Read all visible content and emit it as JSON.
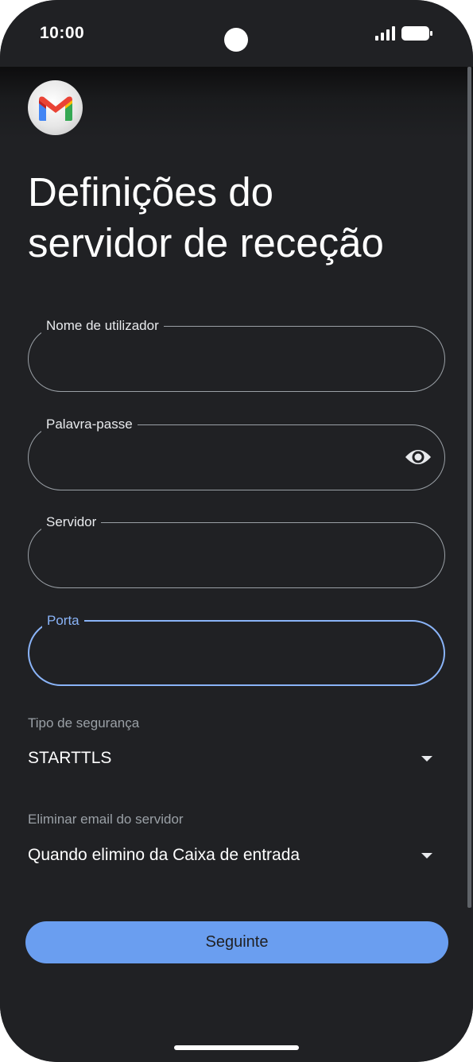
{
  "status_bar": {
    "time": "10:00",
    "signal_icon": "signal-icon",
    "battery_icon": "battery-icon"
  },
  "app": {
    "logo_icon": "gmail-logo-icon"
  },
  "page": {
    "title_line1": "Definições do",
    "title_line2": "servidor de receção"
  },
  "fields": {
    "username": {
      "label": "Nome de utilizador",
      "value": ""
    },
    "password": {
      "label": "Palavra-passe",
      "value": "",
      "toggle_icon": "eye-icon"
    },
    "server": {
      "label": "Servidor",
      "value": ""
    },
    "port": {
      "label": "Porta",
      "value": "",
      "focused": true
    }
  },
  "security": {
    "label": "Tipo de segurança",
    "value": "STARTTLS"
  },
  "delete_policy": {
    "label": "Eliminar email do servidor",
    "value": "Quando elimino da Caixa de entrada"
  },
  "actions": {
    "next_label": "Seguinte"
  },
  "colors": {
    "background": "#202124",
    "accent": "#8ab4f8",
    "button": "#6a9ef0",
    "outline": "#9aa0a6"
  }
}
